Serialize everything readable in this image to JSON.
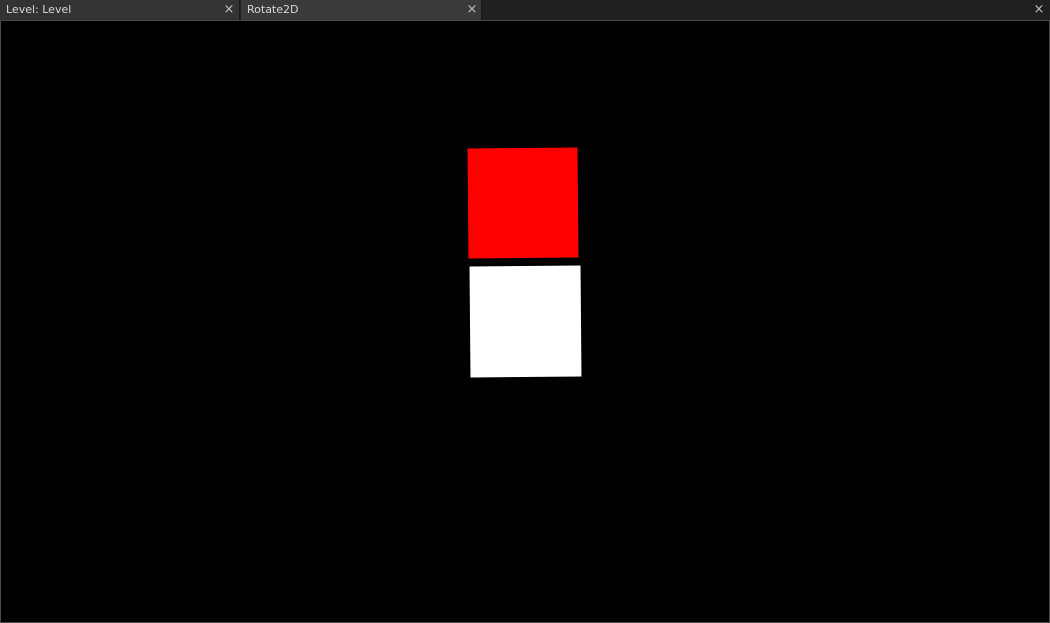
{
  "tabs": [
    {
      "label": "Level: Level"
    },
    {
      "label": "Rotate2D"
    }
  ],
  "window": {
    "close_glyph": "×"
  },
  "colors": {
    "background": "#000000",
    "red_square": "#ff0000",
    "white_square": "#ffffff"
  },
  "icons": {
    "tab_close": "close-icon",
    "window_close": "close-icon"
  }
}
